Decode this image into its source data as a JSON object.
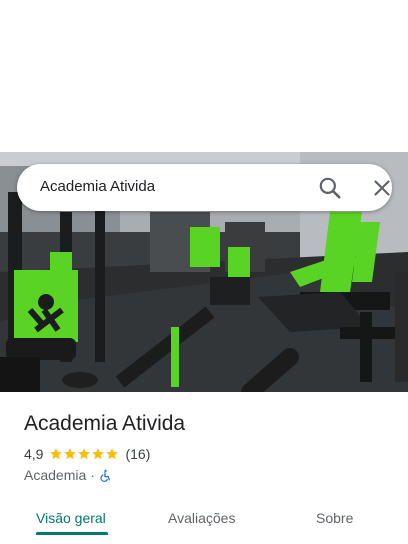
{
  "search": {
    "query": "Academia Ativida",
    "search_icon": "search-icon",
    "close_icon": "close-icon"
  },
  "place": {
    "name": "Academia Ativida",
    "rating": "4,9",
    "stars": 5,
    "review_count": "(16)",
    "category": "Academia",
    "separator": "·",
    "accessibility_icon": "wheelchair-icon"
  },
  "tabs": [
    {
      "label": "Visão geral",
      "active": true
    },
    {
      "label": "Avaliações",
      "active": false
    },
    {
      "label": "Sobre",
      "active": false
    }
  ],
  "colors": {
    "accent": "#00796b",
    "star": "#fbbc04",
    "a11y_icon": "#1a73e8",
    "gym_green": "#5ad424"
  }
}
